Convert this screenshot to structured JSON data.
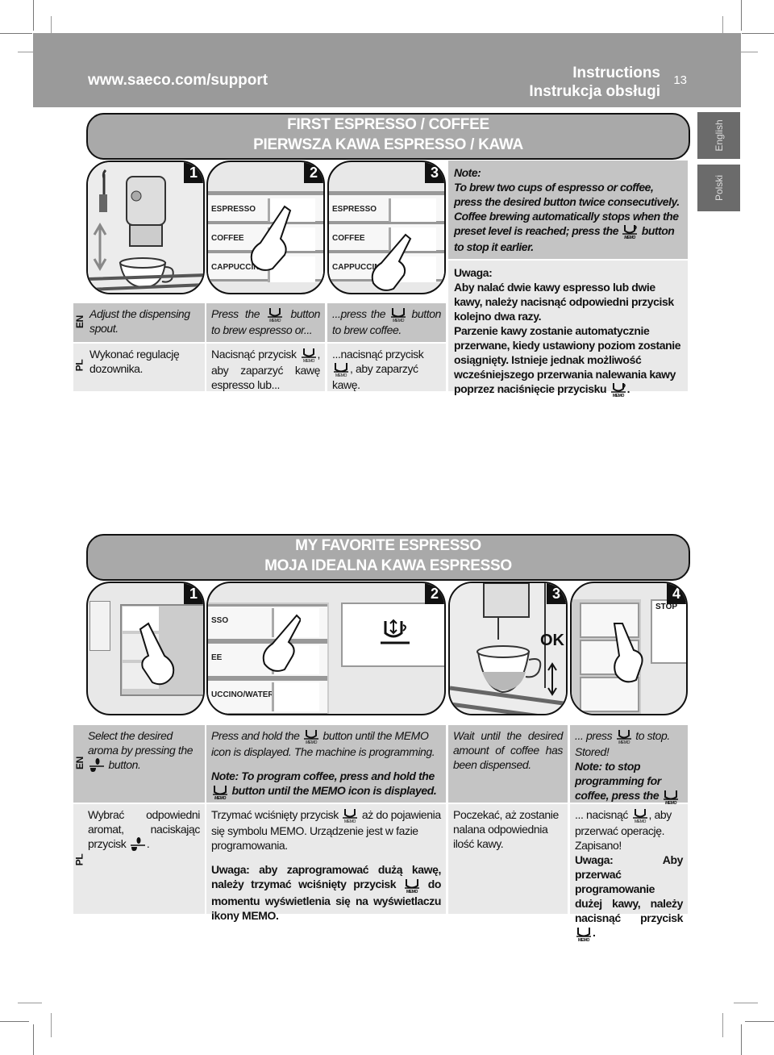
{
  "header": {
    "url": "www.saeco.com/support",
    "title_en": "Instructions",
    "title_pl": "Instrukcja obsługi",
    "page_number": "13"
  },
  "lang_tabs": [
    "English",
    "Polski"
  ],
  "section1": {
    "title_en": "FIRST ESPRESSO / COFFEE",
    "title_pl": "PIERWSZA KAWA ESPRESSO / KAWA",
    "steps": [
      {
        "number": "1",
        "en": "Adjust the dispensing spout.",
        "pl": "Wykonać regulację dozownika."
      },
      {
        "number": "2",
        "en_before": "Press the",
        "en_after": "button to brew espresso or...",
        "pl_before": "Nacisnąć przycisk",
        "pl_after": ", aby zaparzyć kawę espresso lub...",
        "buttons": [
          "ESPRESSO",
          "COFFEE",
          "CAPPUCCINO/WATER"
        ]
      },
      {
        "number": "3",
        "en_before": "...press the",
        "en_after": "button to brew coffee.",
        "pl_before": "...nacisnąć przycisk",
        "pl_after": ", aby zaparzyć kawę.",
        "buttons": [
          "ESPRESSO",
          "COFFEE",
          "CAPPUCCINO"
        ]
      }
    ],
    "note_en": {
      "heading": "Note:",
      "line1": "To brew two cups of espresso or coffee, press the desired button twice consecutively.",
      "line2_before": "Coffee brewing automatically stops when the preset level is reached; press the",
      "line2_after": "button to stop it earlier."
    },
    "note_pl": {
      "heading": "Uwaga:",
      "line1": "Aby nalać dwie kawy espresso lub dwie kawy, należy nacisnąć odpowiedni przycisk kolejno dwa razy.",
      "line2": "Parzenie kawy zostanie automatycznie przerwane, kiedy ustawiony poziom zostanie osiągnięty. Istnieje jednak możliwość wcześniejszego przerwania nalewania kawy poprzez naciśnięcie przycisku",
      "line2_end": "."
    }
  },
  "section2": {
    "title_en": "MY FAVORITE ESPRESSO",
    "title_pl": "MOJA IDEALNA KAWA ESPRESSO",
    "steps": [
      {
        "number": "1",
        "en_before": "Select the desired aroma by pressing the",
        "en_after": "button.",
        "pl_before": "Wybrać odpowiedni aromat, naciskając przycisk",
        "pl_after": "."
      },
      {
        "number": "2",
        "en1_before": "Press and hold the",
        "en1_after": "button until the MEMO icon is displayed. The machine is programming.",
        "en2_before": "Note: To program coffee, press and hold the",
        "en2_after": "button until the MEMO icon is displayed.",
        "pl1_before": "Trzymać wciśnięty przycisk",
        "pl1_after": "aż do pojawienia się symbolu MEMO. Urządzenie jest w fazie programowania.",
        "pl2_before": "Uwaga: aby zaprogramować dużą kawę, należy trzymać wciśnięty przycisk",
        "pl2_after": "do momentu wyświetlenia się na wyświetlaczu ikony MEMO.",
        "buttons": [
          "SSO",
          "EE",
          "UCCINO/WATER"
        ]
      },
      {
        "number": "3",
        "en": "Wait until the desired amount of coffee has been dispensed.",
        "pl": "Poczekać, aż zostanie nalana odpowiednia ilość kawy.",
        "ok_label": "OK"
      },
      {
        "number": "4",
        "en1_before": "... press",
        "en1_after": "to stop.",
        "en_stored": "Stored!",
        "en2_before": "Note: to stop programming for coffee, press the",
        "en2_after": "button.",
        "pl1_before": "... nacisnąć",
        "pl1_after": ", aby przerwać operację.",
        "pl_stored": "Zapisano!",
        "pl2_before": "Uwaga: Aby przerwać programowanie dużej kawy, należy nacisnąć przycisk",
        "pl2_after": ".",
        "stop_label": "STOP",
        "memo_label": "MEMO"
      }
    ]
  },
  "lang_labels": {
    "en": "EN",
    "pl": "PL"
  },
  "icons": {
    "memo_text": "MEMO"
  }
}
